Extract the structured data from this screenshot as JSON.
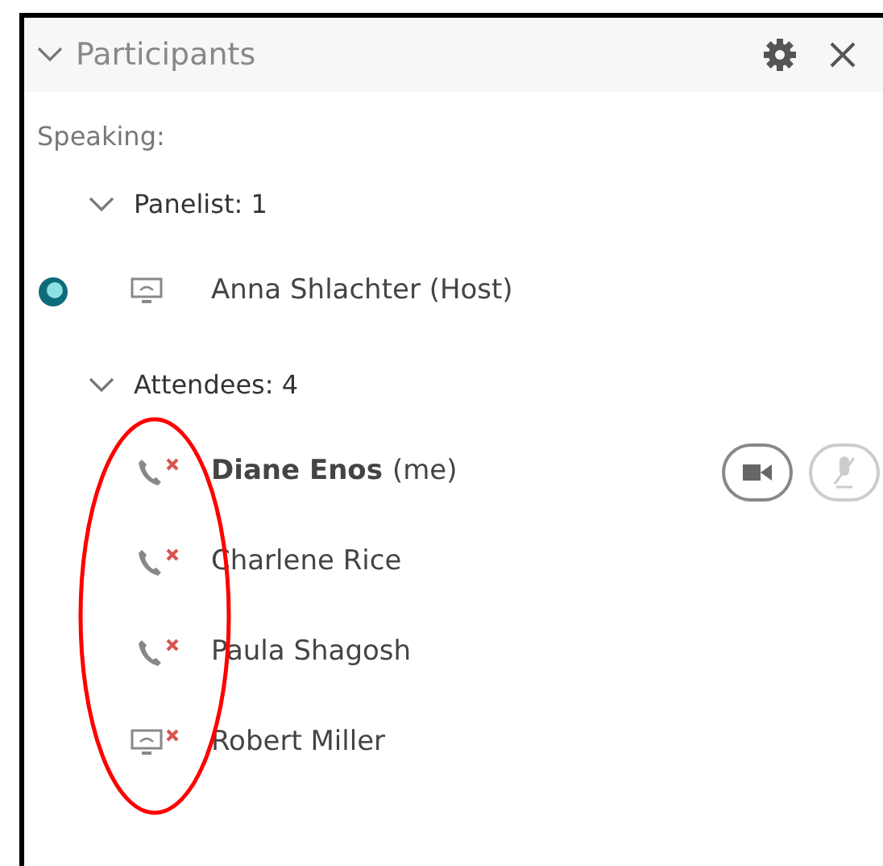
{
  "panel": {
    "title": "Participants",
    "expanded": true
  },
  "speaking_label": "Speaking:",
  "groups": [
    {
      "label": "Panelist: 1",
      "expanded": true,
      "members": [
        {
          "name": "Anna Shlachter (Host)",
          "kind": "computer",
          "disconnected": false,
          "status_dot": true,
          "bold": false
        }
      ]
    },
    {
      "label": "Attendees: 4",
      "expanded": true,
      "members": [
        {
          "name": "Diane Enos",
          "suffix": "(me)",
          "kind": "phone",
          "disconnected": true,
          "status_dot": false,
          "bold": true,
          "controls": true
        },
        {
          "name": "Charlene Rice",
          "kind": "phone",
          "disconnected": true,
          "status_dot": false,
          "bold": false
        },
        {
          "name": "Paula Shagosh",
          "kind": "phone",
          "disconnected": true,
          "status_dot": false,
          "bold": false
        },
        {
          "name": "Robert Miller",
          "kind": "computer",
          "disconnected": true,
          "status_dot": false,
          "bold": false
        }
      ]
    }
  ],
  "annotation": {
    "kind": "ellipse"
  }
}
